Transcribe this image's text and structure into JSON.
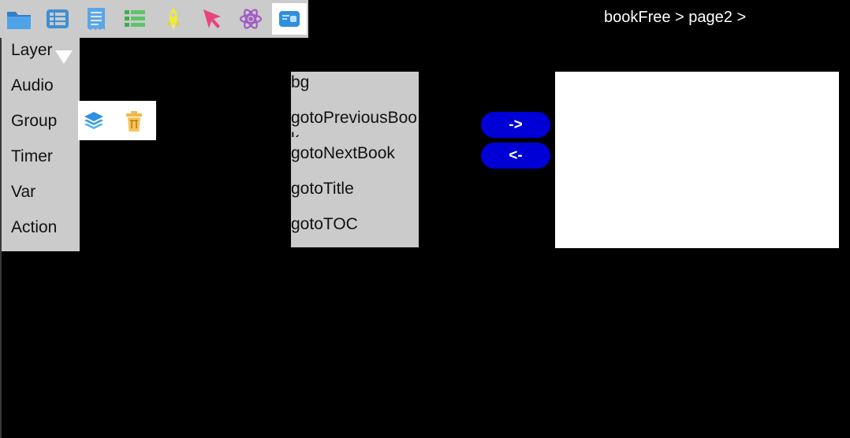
{
  "toolbar": {
    "tools": [
      {
        "icon": "folder-icon",
        "color": "#3d8fd6"
      },
      {
        "icon": "list-icon",
        "color": "#3d8fd6"
      },
      {
        "icon": "receipt-icon",
        "color": "#3d8fd6"
      },
      {
        "icon": "table-list-icon",
        "color": "#36b04a"
      },
      {
        "icon": "rocket-icon",
        "color": "#e8e84a"
      },
      {
        "icon": "cursor-icon",
        "color": "#e0407a"
      },
      {
        "icon": "atom-icon",
        "color": "#9b59b6"
      },
      {
        "icon": "card-icon",
        "color": "#2e8fe0",
        "active": true
      }
    ]
  },
  "breadcrumb": {
    "items": [
      "bookFree",
      " > ",
      "page2",
      " > "
    ]
  },
  "menu": {
    "items": [
      "Layer",
      "Audio",
      "Group",
      "Timer",
      "Var",
      "Action"
    ]
  },
  "group_panel": {
    "icons": [
      "layers-icon",
      "trash-icon"
    ]
  },
  "action_list": {
    "items": [
      "bg",
      "gotoPreviousBook",
      "gotoNextBook",
      "gotoTitle",
      "gotoTOC"
    ]
  },
  "buttons": {
    "add_label": "->",
    "remove_label": "<-"
  }
}
